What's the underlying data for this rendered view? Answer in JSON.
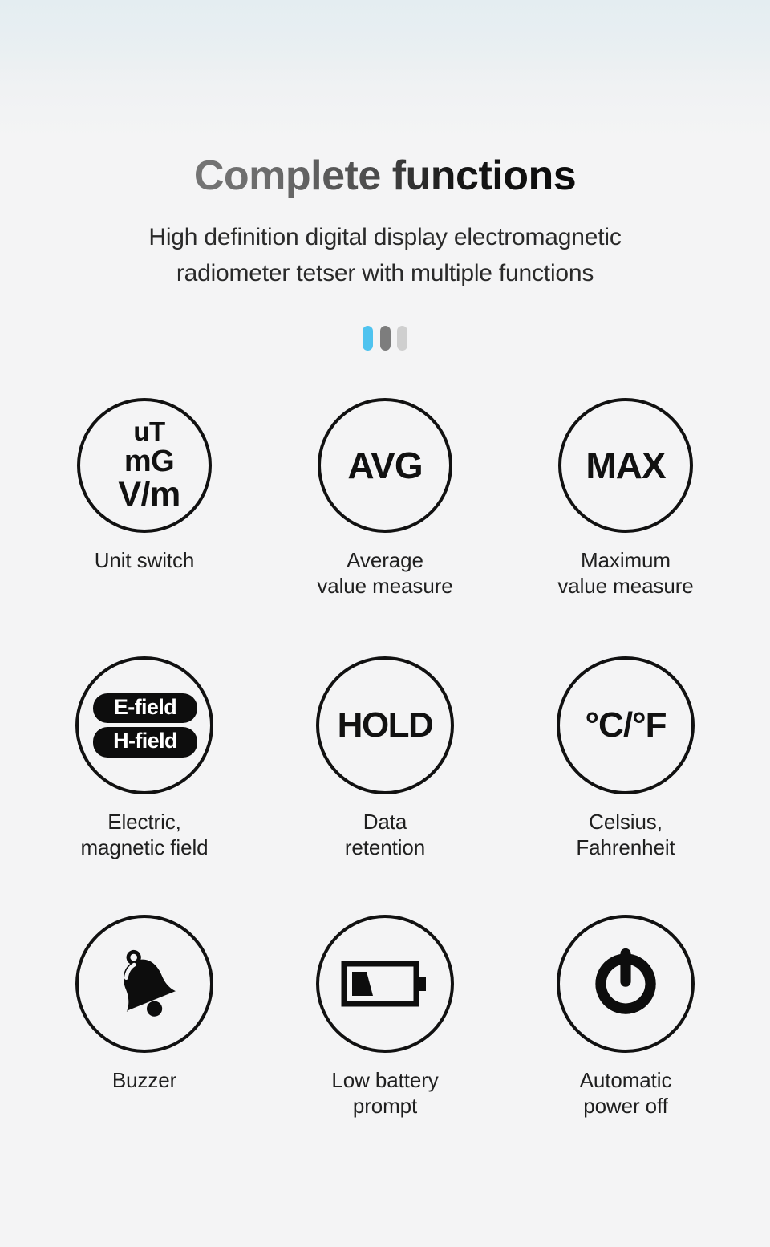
{
  "header": {
    "title": "Complete functions",
    "subtitle_lines": [
      "High definition digital display electromagnetic",
      "radiometer tetser with multiple functions"
    ]
  },
  "decoration": {
    "bars": [
      {
        "name": "bar-accent",
        "color": "#4fc3ef"
      },
      {
        "name": "bar-dark",
        "color": "#7d7d7d"
      },
      {
        "name": "bar-light",
        "color": "#cfcfcf"
      }
    ]
  },
  "features": [
    {
      "id": "unit-switch",
      "icon_type": "text-stack",
      "icon_lines": [
        "uT",
        "mG",
        "V/m"
      ],
      "caption_lines": [
        "Unit switch"
      ]
    },
    {
      "id": "average-value",
      "icon_type": "word",
      "icon_text": "AVG",
      "caption_lines": [
        "Average",
        "value measure"
      ]
    },
    {
      "id": "maximum-value",
      "icon_type": "word",
      "icon_text": "MAX",
      "caption_lines": [
        "Maximum",
        "value measure"
      ]
    },
    {
      "id": "electric-magnetic-field",
      "icon_type": "pills",
      "icon_pills": [
        "E-field",
        "H-field"
      ],
      "caption_lines": [
        "Electric,",
        "magnetic field"
      ]
    },
    {
      "id": "data-retention",
      "icon_type": "word",
      "icon_text": "HOLD",
      "caption_lines": [
        "Data",
        "retention"
      ]
    },
    {
      "id": "celsius-fahrenheit",
      "icon_type": "word",
      "icon_text": "°C/°F",
      "caption_lines": [
        "Celsius,",
        "Fahrenheit"
      ]
    },
    {
      "id": "buzzer",
      "icon_type": "glyph",
      "icon_name": "bell-icon",
      "caption_lines": [
        "Buzzer"
      ]
    },
    {
      "id": "low-battery",
      "icon_type": "glyph",
      "icon_name": "battery-low-icon",
      "caption_lines": [
        "Low battery",
        "prompt"
      ]
    },
    {
      "id": "auto-power-off",
      "icon_type": "glyph",
      "icon_name": "power-icon",
      "caption_lines": [
        "Automatic",
        "power off"
      ]
    }
  ],
  "colors": {
    "ink": "#111111",
    "accent": "#4fc3ef",
    "background_top": "#e4edf1",
    "background_bottom": "#f4f4f5"
  }
}
